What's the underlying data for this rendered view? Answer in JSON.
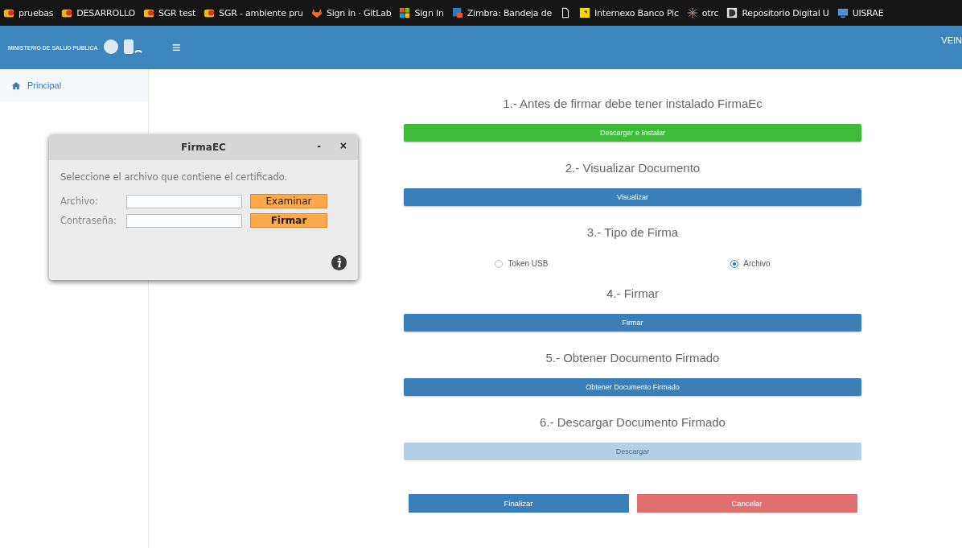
{
  "bookmarks": [
    {
      "kind": "link",
      "label": "pruebas"
    },
    {
      "kind": "link",
      "label": "DESARROLLO"
    },
    {
      "kind": "link",
      "label": "SGR test"
    },
    {
      "kind": "link",
      "label": "SGR - ambiente pru"
    },
    {
      "kind": "link",
      "label": "Sign in · GitLab"
    },
    {
      "kind": "link",
      "label": "Sign In"
    },
    {
      "kind": "link",
      "label": "Zimbra: Bandeja de"
    },
    {
      "kind": "icon"
    },
    {
      "kind": "link",
      "label": "Internexo Banco Pic"
    },
    {
      "kind": "link",
      "label": "otrc"
    },
    {
      "kind": "link",
      "label": "Repositorio Digital U"
    },
    {
      "kind": "link",
      "label": "UISRAE"
    }
  ],
  "header": {
    "logo_text": "MINISTERIO DE SALUD PUBLICA",
    "menu_icon": "≡",
    "user": "VEIN"
  },
  "sidebar": {
    "items": [
      {
        "label": "Principal"
      }
    ]
  },
  "steps": [
    {
      "title": "1.- Antes de firmar debe tener instalado FirmaEc",
      "kind": "button",
      "button": {
        "label": "Descargar e Instalar",
        "color": "#3fbb3a",
        "disabled": false
      }
    },
    {
      "title": "2.- Visualizar Documento",
      "kind": "button",
      "button": {
        "label": "Visualizar",
        "color": "#3a7fb8",
        "disabled": false
      }
    },
    {
      "title": "3.- Tipo de Firma",
      "kind": "radio",
      "options": [
        {
          "label": "Token USB",
          "selected": false
        },
        {
          "label": "Archivo",
          "selected": true
        }
      ]
    },
    {
      "title": "4.- Firmar",
      "kind": "button",
      "button": {
        "label": "Firmar",
        "color": "#3a7fb8",
        "disabled": false
      }
    },
    {
      "title": "5.- Obtener Documento Firmado",
      "kind": "button",
      "button": {
        "label": "Obtener Documento Firmado",
        "color": "#3a7fb8",
        "disabled": false
      }
    },
    {
      "title": "6.- Descargar Documento Firmado",
      "kind": "button",
      "button": {
        "label": "Descargar",
        "color": "#b3d0e6",
        "disabled": true
      }
    }
  ],
  "actions": [
    {
      "label": "Finalizar",
      "color": "#3a7fb8"
    },
    {
      "label": "Cancelar",
      "color": "#e07070"
    }
  ],
  "dialog": {
    "title": "FirmaEC",
    "minimize": "-",
    "close": "×",
    "message": "Seleccione el archivo que contiene el certificado.",
    "fields": [
      {
        "label": "Archivo:",
        "button": "Examinar"
      },
      {
        "label": "Contraseña:",
        "button": "Firmar"
      }
    ]
  }
}
